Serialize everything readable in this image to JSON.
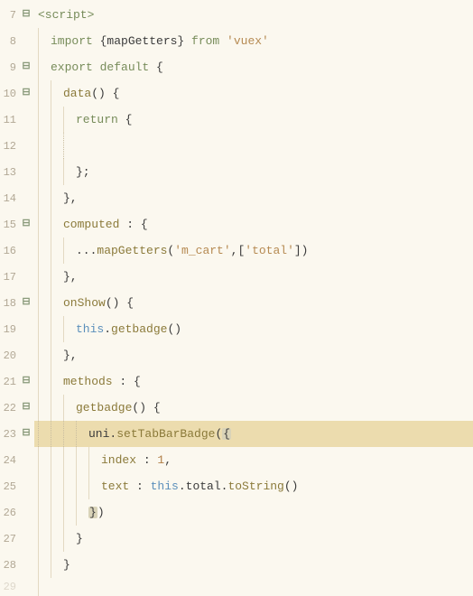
{
  "lines": [
    {
      "n": 7,
      "fold": "⊟",
      "hl": false,
      "segs": [
        {
          "t": "<script>",
          "c": "tag"
        }
      ]
    },
    {
      "n": 8,
      "fold": "",
      "hl": false,
      "guides": 1,
      "segs": [
        {
          "t": "import ",
          "c": "kw"
        },
        {
          "t": "{mapGetters} ",
          "c": "ident"
        },
        {
          "t": "from ",
          "c": "kw"
        },
        {
          "t": "'vuex'",
          "c": "str"
        }
      ]
    },
    {
      "n": 9,
      "fold": "⊟",
      "hl": false,
      "guides": 1,
      "segs": [
        {
          "t": "export default ",
          "c": "kw"
        },
        {
          "t": "{",
          "c": "punct"
        }
      ]
    },
    {
      "n": 10,
      "fold": "⊟",
      "hl": false,
      "guides": 2,
      "segs": [
        {
          "t": "data",
          "c": "fn"
        },
        {
          "t": "() {",
          "c": "punct"
        }
      ]
    },
    {
      "n": 11,
      "fold": "",
      "hl": false,
      "guides": 3,
      "segs": [
        {
          "t": "return ",
          "c": "kw"
        },
        {
          "t": "{",
          "c": "punct"
        }
      ]
    },
    {
      "n": 12,
      "fold": "",
      "hl": false,
      "guides": 3,
      "dot": true,
      "segs": []
    },
    {
      "n": 13,
      "fold": "",
      "hl": false,
      "guides": 3,
      "segs": [
        {
          "t": "};",
          "c": "punct"
        }
      ]
    },
    {
      "n": 14,
      "fold": "",
      "hl": false,
      "guides": 2,
      "segs": [
        {
          "t": "},",
          "c": "punct"
        }
      ]
    },
    {
      "n": 15,
      "fold": "⊟",
      "hl": false,
      "guides": 2,
      "segs": [
        {
          "t": "computed ",
          "c": "prop"
        },
        {
          "t": ": {",
          "c": "punct"
        }
      ]
    },
    {
      "n": 16,
      "fold": "",
      "hl": false,
      "guides": 3,
      "segs": [
        {
          "t": "...",
          "c": "punct"
        },
        {
          "t": "mapGetters",
          "c": "fn"
        },
        {
          "t": "(",
          "c": "punct"
        },
        {
          "t": "'m_cart'",
          "c": "str"
        },
        {
          "t": ",[",
          "c": "punct"
        },
        {
          "t": "'total'",
          "c": "str"
        },
        {
          "t": "])",
          "c": "punct"
        }
      ]
    },
    {
      "n": 17,
      "fold": "",
      "hl": false,
      "guides": 2,
      "segs": [
        {
          "t": "},",
          "c": "punct"
        }
      ]
    },
    {
      "n": 18,
      "fold": "⊟",
      "hl": false,
      "guides": 2,
      "segs": [
        {
          "t": "onShow",
          "c": "fn"
        },
        {
          "t": "() {",
          "c": "punct"
        }
      ]
    },
    {
      "n": 19,
      "fold": "",
      "hl": false,
      "guides": 3,
      "segs": [
        {
          "t": "this",
          "c": "this"
        },
        {
          "t": ".",
          "c": "punct"
        },
        {
          "t": "getbadge",
          "c": "fn"
        },
        {
          "t": "()",
          "c": "punct"
        }
      ]
    },
    {
      "n": 20,
      "fold": "",
      "hl": false,
      "guides": 2,
      "segs": [
        {
          "t": "},",
          "c": "punct"
        }
      ]
    },
    {
      "n": 21,
      "fold": "⊟",
      "hl": false,
      "guides": 2,
      "segs": [
        {
          "t": "methods ",
          "c": "prop"
        },
        {
          "t": ": {",
          "c": "punct"
        }
      ]
    },
    {
      "n": 22,
      "fold": "⊟",
      "hl": false,
      "guides": 3,
      "segs": [
        {
          "t": "getbadge",
          "c": "fn"
        },
        {
          "t": "() {",
          "c": "punct"
        }
      ]
    },
    {
      "n": 23,
      "fold": "⊟",
      "hl": true,
      "guides": 4,
      "allDot": true,
      "segs": [
        {
          "t": "uni.",
          "c": "ident"
        },
        {
          "t": "setTabBarBadge",
          "c": "fn"
        },
        {
          "t": "(",
          "c": "punct"
        },
        {
          "t": "{",
          "c": "punct",
          "m": true
        }
      ]
    },
    {
      "n": 24,
      "fold": "",
      "hl": false,
      "guides": 5,
      "segs": [
        {
          "t": "index ",
          "c": "prop"
        },
        {
          "t": ": ",
          "c": "punct"
        },
        {
          "t": "1",
          "c": "num"
        },
        {
          "t": ",",
          "c": "punct"
        }
      ]
    },
    {
      "n": 25,
      "fold": "",
      "hl": false,
      "guides": 5,
      "segs": [
        {
          "t": "text ",
          "c": "prop"
        },
        {
          "t": ": ",
          "c": "punct"
        },
        {
          "t": "this",
          "c": "this"
        },
        {
          "t": ".total.",
          "c": "punct"
        },
        {
          "t": "toString",
          "c": "fn"
        },
        {
          "t": "()",
          "c": "punct"
        }
      ]
    },
    {
      "n": 26,
      "fold": "",
      "hl": false,
      "guides": 4,
      "segs": [
        {
          "t": "}",
          "c": "punct",
          "m": true
        },
        {
          "t": ")",
          "c": "punct"
        }
      ]
    },
    {
      "n": 27,
      "fold": "",
      "hl": false,
      "guides": 3,
      "segs": [
        {
          "t": "}",
          "c": "punct"
        }
      ]
    },
    {
      "n": 28,
      "fold": "",
      "hl": false,
      "guides": 2,
      "segs": [
        {
          "t": "}",
          "c": "punct"
        }
      ]
    }
  ],
  "nextLine": 29
}
